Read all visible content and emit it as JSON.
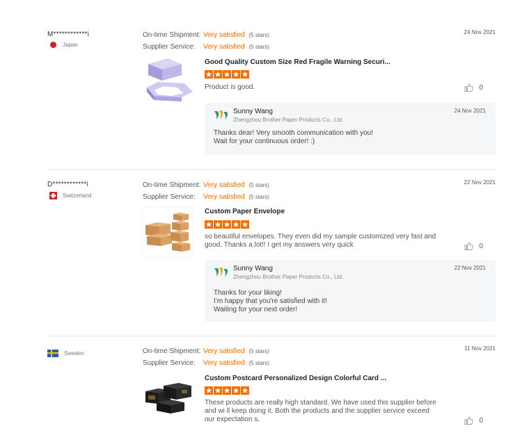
{
  "reviews": [
    {
      "buyer": "M************i",
      "country": "Japan",
      "ratings": [
        {
          "label": "On-time Shipment:",
          "value": "Very satisfied",
          "stars": "(5 stars)"
        },
        {
          "label": "Supplier Service:",
          "value": "Very satisfied",
          "stars": "(5 stars)"
        }
      ],
      "date": "24 Nov 2021",
      "product_title": "Good Quality Custom Size Red Fragile Warning Securi...",
      "product_rating": 5,
      "text": "Product is good.",
      "likes": "0",
      "reply": {
        "name": "Sunny Wang",
        "company": "Zhengzhou Brother Paper Products Co., Ltd.",
        "date": "24 Nov 2021",
        "text": "Thanks dear! Very smooth communication with you!\nWait for your continuous order!  :)"
      }
    },
    {
      "buyer": "D************i",
      "country": "Switzerland",
      "ratings": [
        {
          "label": "On-time Shipment:",
          "value": "Very satisfied",
          "stars": "(5 stars)"
        },
        {
          "label": "Supplier Service:",
          "value": "Very satisfied",
          "stars": "(5 stars)"
        }
      ],
      "date": "22 Nov 2021",
      "product_title": "Custom Paper Envelope",
      "product_rating": 5,
      "text": "so beautiful envelopes. They even did my sample customized very fast and good. Thanks a lot!! I get my answers very quick",
      "likes": "0",
      "reply": {
        "name": "Sunny Wang",
        "company": "Zhengzhou Brother Paper Products Co., Ltd.",
        "date": "22 Nov 2021",
        "text": "Thanks for your liking!\nI'm happy that you're satisfied with it!\nWaiting for your next order!"
      }
    },
    {
      "buyer": "",
      "country": "Sweden",
      "ratings": [
        {
          "label": "On-time Shipment:",
          "value": "Very satisfied",
          "stars": "(5 stars)"
        },
        {
          "label": "Supplier Service:",
          "value": "Very satisfied",
          "stars": "(5 stars)"
        }
      ],
      "date": "11 Nov 2021",
      "product_title": "Custom Postcard Personalized Design Colorful Card ...",
      "product_rating": 5,
      "text": "These products are really high standard. We have used this supplier before and wi ll keep doing it. Both the products and the supplier service exceed our expectation s.",
      "likes": "0"
    }
  ],
  "colors": {
    "accent": "#ff6a00",
    "reply_bg": "#f5f6f8",
    "divider": "#e6e6e6"
  },
  "icons": {
    "like": "thumbs-up-icon",
    "star": "star-icon",
    "logo": "company-logo-icon"
  }
}
